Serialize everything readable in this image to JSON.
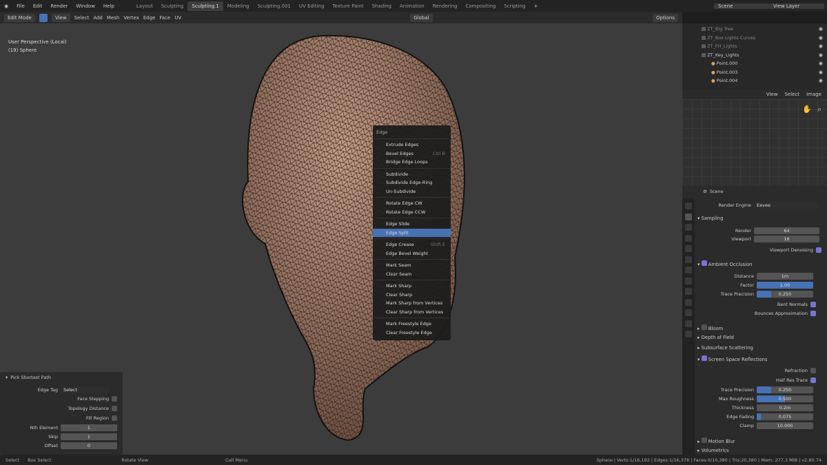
{
  "topbar": {
    "menus": [
      "File",
      "Edit",
      "Render",
      "Window",
      "Help"
    ],
    "tabs": [
      "Layout",
      "Sculpting",
      "Sculpting.1",
      "Modeling",
      "Sculpting.001",
      "UV Editing",
      "Texture Paint",
      "Shading",
      "Animation",
      "Rendering",
      "Compositing",
      "Scripting"
    ],
    "active_tab": "Sculpting.1",
    "scene": "Scene",
    "view_layer": "View Layer"
  },
  "header": {
    "mode": "Edit Mode",
    "menus": [
      "View",
      "Select",
      "Add",
      "Mesh",
      "Vertex",
      "Edge",
      "Face",
      "UV"
    ],
    "orientation": "Global",
    "options": "Options"
  },
  "viewport": {
    "view_name": "User Perspective (Local)",
    "object": "(19) Sphere"
  },
  "edge_menu": {
    "title": "Edge",
    "groups": [
      [
        {
          "label": "Extrude Edges"
        },
        {
          "label": "Bevel Edges",
          "shortcut": "Ctrl B"
        },
        {
          "label": "Bridge Edge Loops"
        }
      ],
      [
        {
          "label": "Subdivide"
        },
        {
          "label": "Subdivide Edge-Ring"
        },
        {
          "label": "Un-Subdivide"
        }
      ],
      [
        {
          "label": "Rotate Edge CW"
        },
        {
          "label": "Rotate Edge CCW"
        }
      ],
      [
        {
          "label": "Edge Slide"
        },
        {
          "label": "Edge Split",
          "highlighted": true
        }
      ],
      [
        {
          "label": "Edge Crease",
          "shortcut": "Shift E"
        },
        {
          "label": "Edge Bevel Weight"
        }
      ],
      [
        {
          "label": "Mark Seam"
        },
        {
          "label": "Clear Seam"
        }
      ],
      [
        {
          "label": "Mark Sharp"
        },
        {
          "label": "Clear Sharp"
        },
        {
          "label": "Mark Sharp from Vertices"
        },
        {
          "label": "Clear Sharp from Vertices"
        }
      ],
      [
        {
          "label": "Mark Freestyle Edge"
        },
        {
          "label": "Clear Freestyle Edge"
        }
      ]
    ]
  },
  "operator": {
    "title": "Pick Shortest Path",
    "edge_tag_label": "Edge Tag",
    "edge_tag": "Select",
    "face_stepping": "Face Stepping",
    "topology_distance": "Topology Distance",
    "fill_region": "Fill Region",
    "nth_label": "Nth Element",
    "nth": "1",
    "skip_label": "Skip",
    "skip": "1",
    "offset_label": "Offset",
    "offset": "0"
  },
  "outliner": {
    "items": [
      "ZT_Big Tree",
      "ZT_Box Lights Curves",
      "ZT_FH_Lights",
      "ZT_Key_Lights",
      "Point.000",
      "Point.003",
      "Point.004"
    ]
  },
  "image_editor": {
    "menus": [
      "View",
      "Select",
      "Image"
    ]
  },
  "properties": {
    "context": "Scene",
    "render_engine_label": "Render Engine",
    "render_engine": "Eevee",
    "sampling": "Sampling",
    "render_label": "Render",
    "render": "64",
    "viewport_label": "Viewport",
    "viewport": "16",
    "viewport_denoising": "Viewport Denoising",
    "ao": "Ambient Occlusion",
    "distance_label": "Distance",
    "distance": "1m",
    "factor_label": "Factor",
    "factor": "1.00",
    "factor_fill": 1.0,
    "trace_label": "Trace Precision",
    "trace": "0.250",
    "trace_fill": 0.25,
    "bent_normals": "Bent Normals",
    "bounces": "Bounces Approximation",
    "bloom": "Bloom",
    "dof": "Depth of Field",
    "sss": "Subsurface Scattering",
    "ssr": "Screen Space Reflections",
    "refraction": "Refraction",
    "half_res": "Half Res Trace",
    "ssr_trace_label": "Trace Precision",
    "ssr_trace": "0.250",
    "max_rough_label": "Max Roughness",
    "max_rough": "0.500",
    "max_rough_fill": 0.5,
    "thickness_label": "Thickness",
    "thickness": "0.2m",
    "edge_fading_label": "Edge Fading",
    "edge_fading": "0.075",
    "edge_fading_fill": 0.075,
    "clamp_label": "Clamp",
    "clamp": "10.000",
    "motion_blur": "Motion Blur",
    "volumetrics": "Volumetrics"
  },
  "status": {
    "select": "Select",
    "box_select": "Box Select",
    "rotate": "Rotate View",
    "call_menu": "Call Menu",
    "stats": "Sphere | Verts:1/16,192 | Edges:1/16,378 | Faces:0/10,380 | Tris:20,380 | Mem: 277.3 MiB | v2.80.74"
  },
  "colors": {
    "accent": "#4772b3",
    "mesh": "#a07c6a"
  }
}
